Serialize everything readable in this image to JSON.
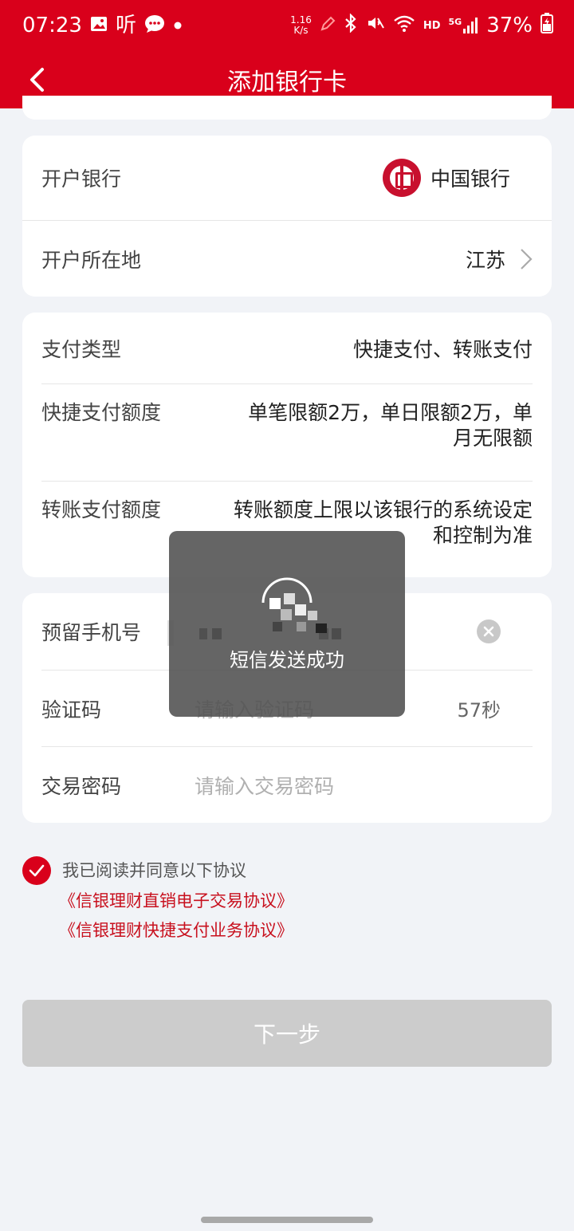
{
  "status_bar": {
    "time": "07:23",
    "listen_label": "听",
    "speed_value": "1.16",
    "speed_unit": "K/s",
    "network": "HD",
    "signal": "5G",
    "battery": "37%"
  },
  "nav": {
    "title": "添加银行卡"
  },
  "bank_card": {
    "bank_label": "开户银行",
    "bank_name": "中国银行",
    "location_label": "开户所在地",
    "location_value": "江苏"
  },
  "payment_card": {
    "type_label": "支付类型",
    "type_value": "快捷支付、转账支付",
    "quick_limit_label": "快捷支付额度",
    "quick_limit_line1": "单笔限额2万，单日限额2万，单",
    "quick_limit_line2": "月无限额",
    "transfer_limit_label": "转账支付额度",
    "transfer_limit_line1": "转账额度上限以该银行的系统设定",
    "transfer_limit_line2": "和控制为准"
  },
  "verify_card": {
    "phone_label": "预留手机号",
    "code_label": "验证码",
    "code_placeholder": "请输入验证码",
    "countdown": "57秒",
    "password_label": "交易密码",
    "password_placeholder": "请输入交易密码"
  },
  "agreement": {
    "text": "我已阅读并同意以下协议",
    "link1": "《信银理财直销电子交易协议》",
    "link2": "《信银理财快捷支付业务协议》",
    "checked": true
  },
  "next_button": {
    "label": "下一步"
  },
  "toast": {
    "message": "短信发送成功"
  },
  "colors": {
    "brand_red": "#d9001b",
    "link_red": "#c8101e",
    "disabled_button": "#cccccc"
  }
}
